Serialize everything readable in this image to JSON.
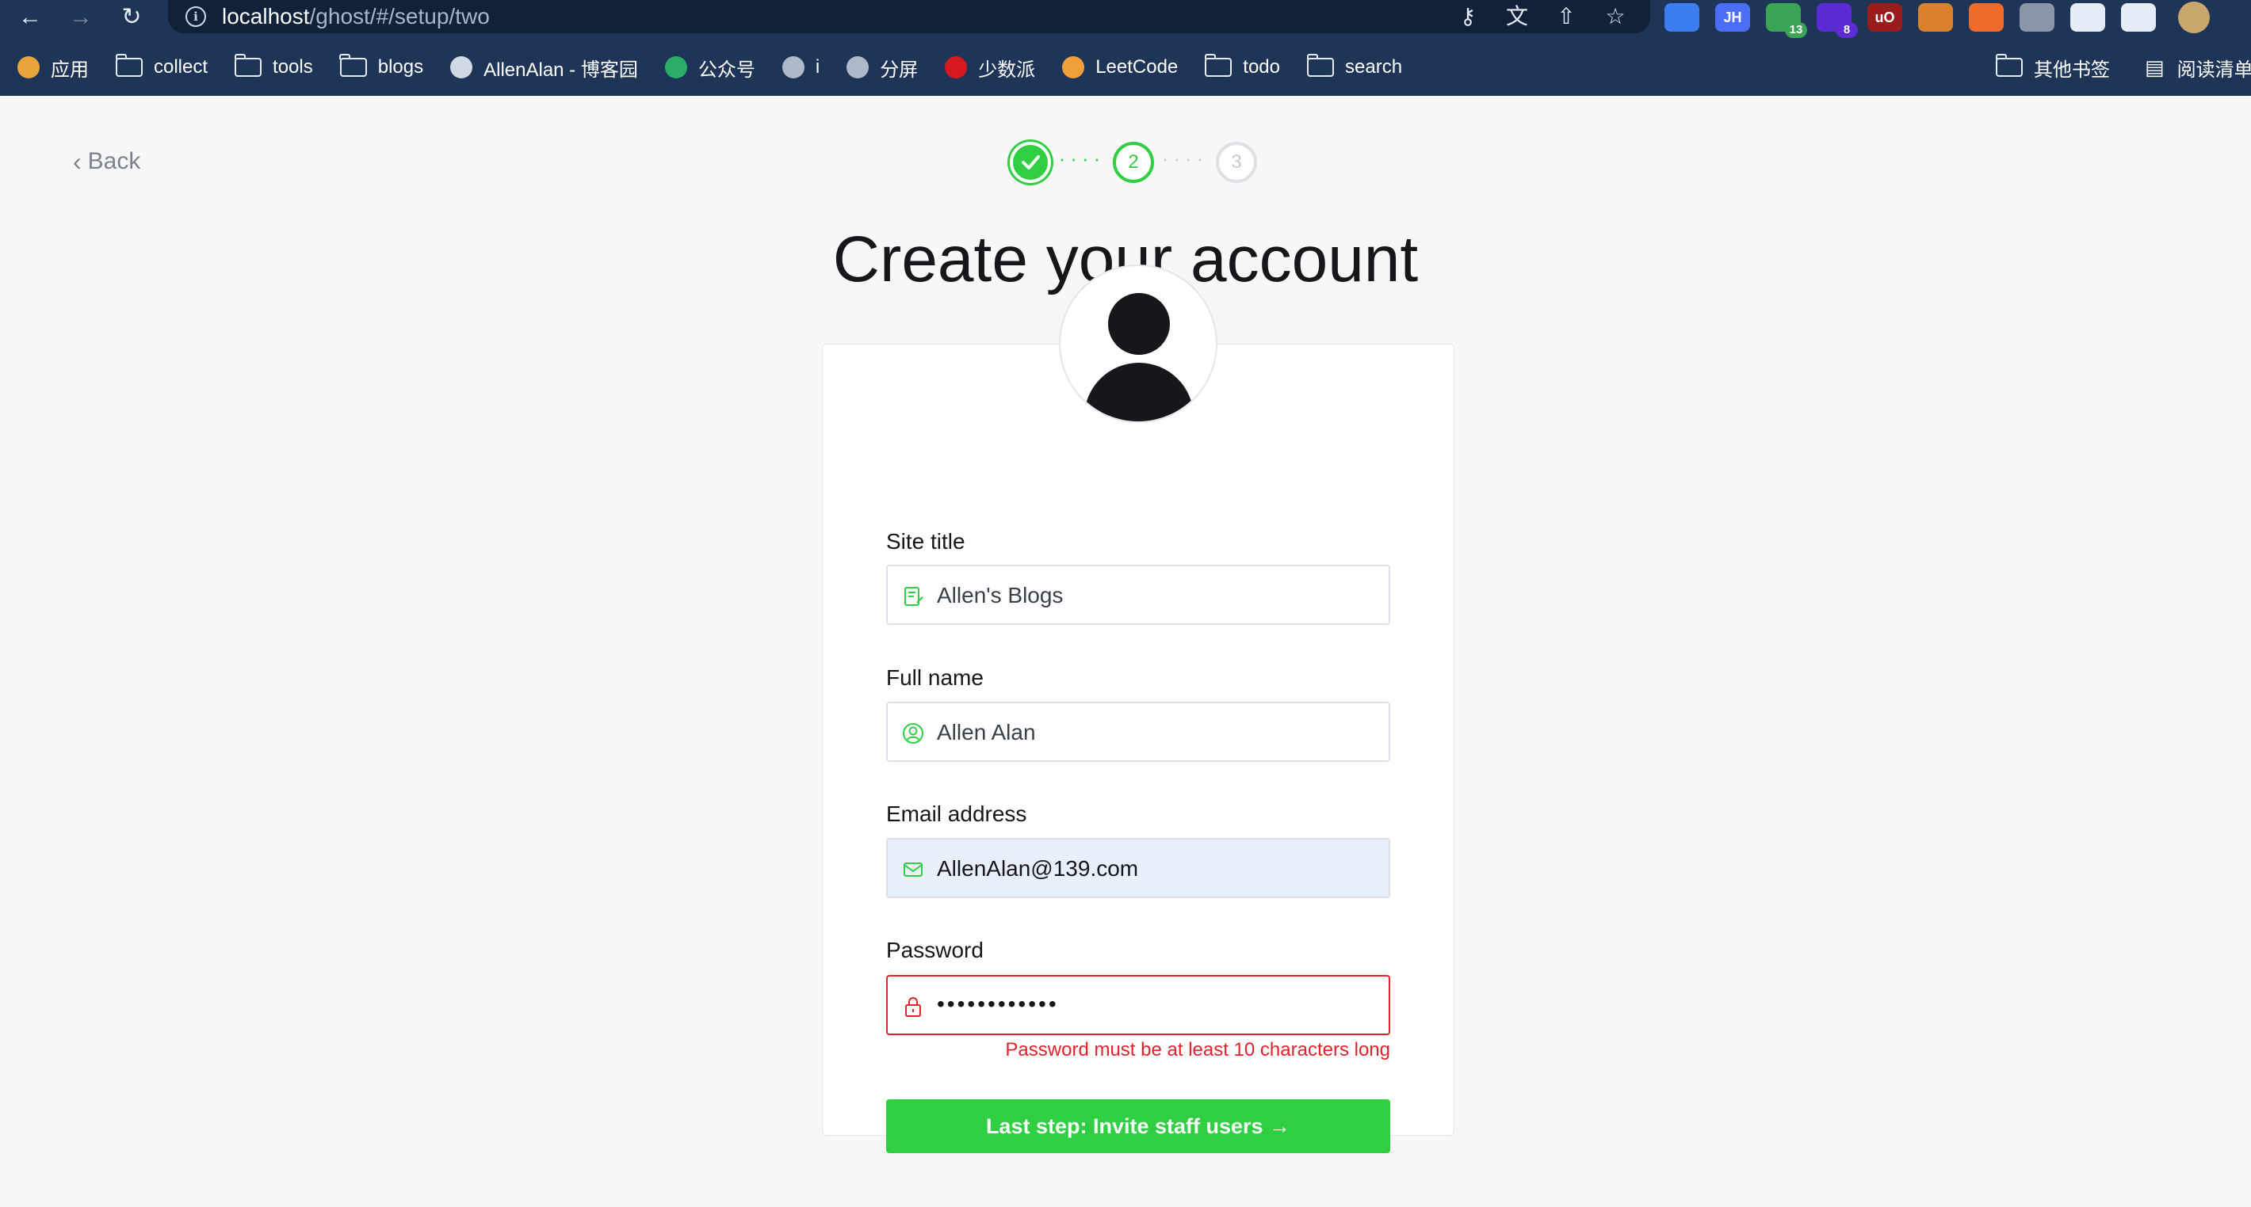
{
  "browser": {
    "url_host": "localhost",
    "url_path": "/ghost/#/setup/two",
    "extensions": [
      {
        "name": "pocket-ext-icon",
        "label": "",
        "color": "#3c7df0"
      },
      {
        "name": "jh-ext-icon",
        "label": "JH",
        "color": "#4c6ef5"
      },
      {
        "name": "green-ext-icon",
        "label": "",
        "color": "#3aa555",
        "badge": "13",
        "badge_color": "#3aa555"
      },
      {
        "name": "purple-ext-icon",
        "label": "",
        "color": "#5b2bd6",
        "badge": "8",
        "badge_color": "#5b2bd6"
      },
      {
        "name": "ublock-ext-icon",
        "label": "uO",
        "color": "#9b1c1c"
      },
      {
        "name": "ext-icon-6",
        "label": "",
        "color": "#d9822b"
      },
      {
        "name": "ext-icon-7",
        "label": "",
        "color": "#f06a2a"
      },
      {
        "name": "ext-icon-8",
        "label": "",
        "color": "#8a96a8"
      },
      {
        "name": "ext-icon-9",
        "label": "",
        "color": "#e6ecf5"
      },
      {
        "name": "puzzle-ext-icon",
        "label": "",
        "color": "#e6ecf5"
      }
    ],
    "bookmarks": [
      {
        "label": "应用",
        "icon": "apps-grid-icon"
      },
      {
        "label": "collect",
        "icon": "folder-icon"
      },
      {
        "label": "tools",
        "icon": "folder-icon"
      },
      {
        "label": "blogs",
        "icon": "folder-icon"
      },
      {
        "label": "AllenAlan - 博客园",
        "icon": "cnblogs-icon"
      },
      {
        "label": "公众号",
        "icon": "wechat-icon"
      },
      {
        "label": "i",
        "icon": "globe-icon"
      },
      {
        "label": "分屏",
        "icon": "globe-icon"
      },
      {
        "label": "少数派",
        "icon": "sspai-icon"
      },
      {
        "label": "LeetCode",
        "icon": "leetcode-icon"
      },
      {
        "label": "todo",
        "icon": "folder-icon"
      },
      {
        "label": "search",
        "icon": "folder-icon"
      }
    ],
    "other_bookmarks": "其他书签",
    "reading_list": "阅读清单"
  },
  "setup": {
    "back_label": "Back",
    "steps": [
      "1",
      "2",
      "3"
    ],
    "title": "Create your account",
    "fields": {
      "site_title": {
        "label": "Site title",
        "value": "Allen's Blogs"
      },
      "full_name": {
        "label": "Full name",
        "value": "Allen Alan"
      },
      "email": {
        "label": "Email address",
        "value": "AllenAlan@139.com"
      },
      "password": {
        "label": "Password",
        "value": "••••••••••••"
      }
    },
    "password_error": "Password must be at least 10 characters long",
    "submit_label": "Last step: Invite staff users →",
    "colors": {
      "accent": "#30cf43",
      "error": "#e2222b",
      "autofill": "#e8f0fe"
    }
  }
}
